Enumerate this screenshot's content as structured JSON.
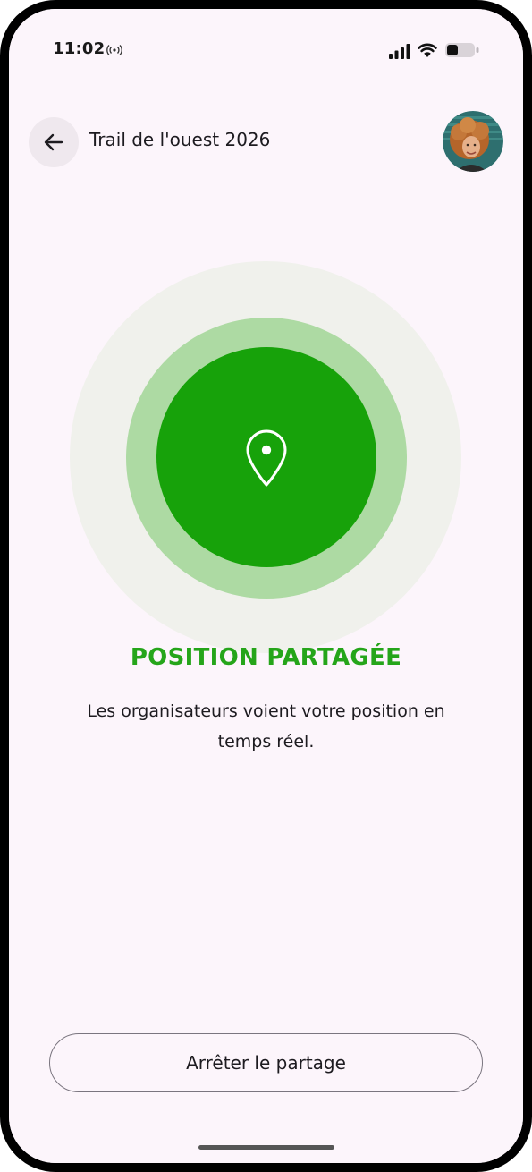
{
  "status_bar": {
    "time": "11:02",
    "icons": [
      "broadcast-icon",
      "signal-icon",
      "wifi-icon",
      "battery-icon"
    ]
  },
  "header": {
    "back_icon": "arrow-left-icon",
    "title": "Trail de l'ouest 2026",
    "avatar": "user-avatar"
  },
  "sharing": {
    "icon": "location-pin-icon",
    "heading": "POSITION PARTAGÉE",
    "description": "Les organisateurs voient votre position en temps réel.",
    "colors": {
      "accent": "#17a20a",
      "heading": "#25a51a",
      "halo": "#addaa3",
      "outer": "#f0f1ec"
    }
  },
  "actions": {
    "stop_label": "Arrêter le partage"
  }
}
